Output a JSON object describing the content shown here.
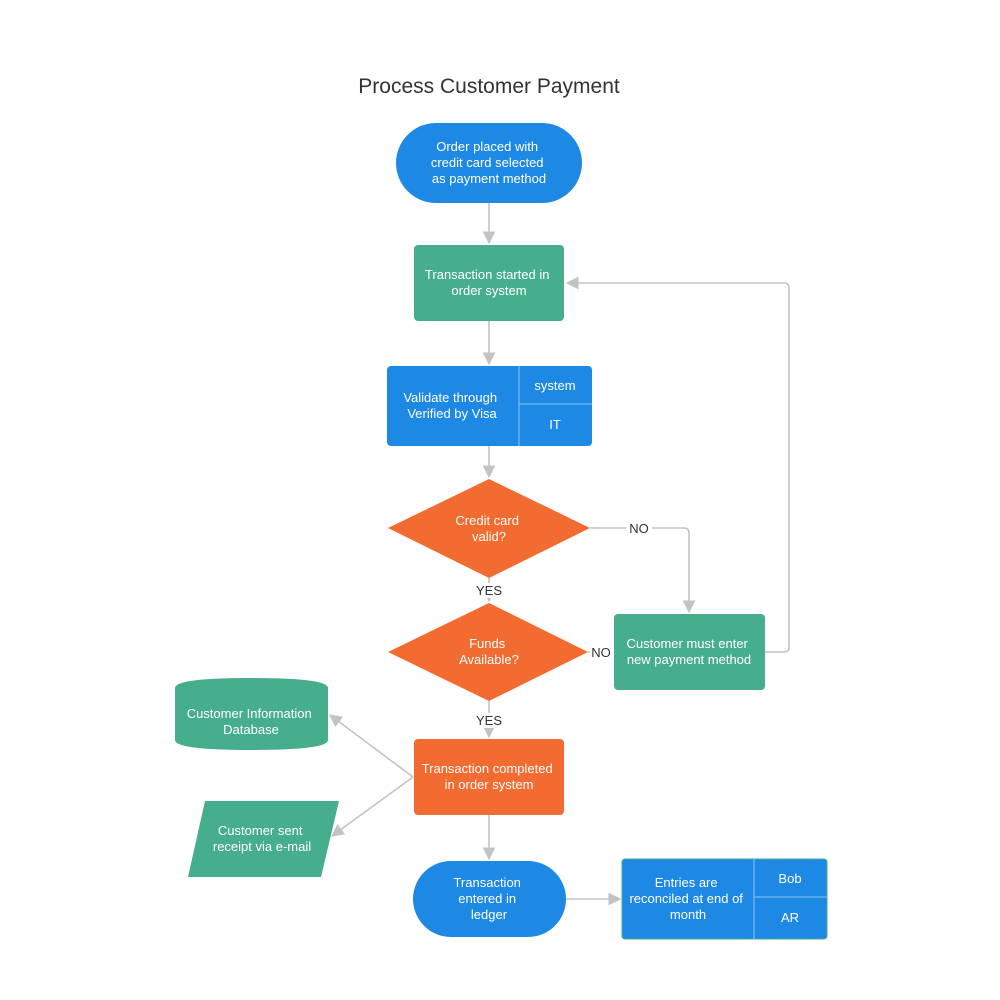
{
  "title": "Process Customer Payment",
  "colors": {
    "blue": "#1e88e5",
    "green": "#46ad8d",
    "orange": "#f26b30",
    "connector": "#c3c3c3",
    "divider": "#8cc4f1",
    "title_text": "#333333",
    "node_text": "#ffffff"
  },
  "nodes": {
    "start": {
      "type": "terminator",
      "color": "blue",
      "lines": [
        "Order placed with",
        "credit card selected",
        "as payment method"
      ]
    },
    "started": {
      "type": "process",
      "color": "green",
      "lines": [
        "Transaction started in",
        "order system"
      ]
    },
    "validate": {
      "type": "process-swimlane",
      "color": "blue",
      "lines": [
        "Validate through",
        "Verified by Visa"
      ],
      "lane_top": "system",
      "lane_bottom": "IT"
    },
    "cc_valid": {
      "type": "decision",
      "color": "orange",
      "lines": [
        "Credit card",
        "valid?"
      ]
    },
    "funds": {
      "type": "decision",
      "color": "orange",
      "lines": [
        "Funds",
        "Available?"
      ]
    },
    "new_payment": {
      "type": "process",
      "color": "green",
      "lines": [
        "Customer must enter",
        "new payment method"
      ]
    },
    "database": {
      "type": "database",
      "color": "green",
      "lines": [
        "Customer Information",
        "Database"
      ]
    },
    "receipt": {
      "type": "data",
      "color": "green",
      "lines": [
        "Customer sent",
        "receipt via e-mail"
      ]
    },
    "completed": {
      "type": "process",
      "color": "orange",
      "lines": [
        "Transaction completed",
        "in order system"
      ]
    },
    "ledger": {
      "type": "terminator",
      "color": "blue",
      "lines": [
        "Transaction",
        "entered in",
        "ledger"
      ]
    },
    "reconcile": {
      "type": "process-swimlane",
      "color": "blue",
      "lines": [
        "Entries are",
        "reconciled at end of",
        "month"
      ],
      "lane_top": "Bob",
      "lane_bottom": "AR"
    }
  },
  "edges": [
    {
      "from": "start",
      "to": "started",
      "label": ""
    },
    {
      "from": "started",
      "to": "validate",
      "label": ""
    },
    {
      "from": "validate",
      "to": "cc_valid",
      "label": ""
    },
    {
      "from": "cc_valid",
      "to": "funds",
      "label": "YES"
    },
    {
      "from": "cc_valid",
      "to": "new_payment",
      "label": "NO"
    },
    {
      "from": "funds",
      "to": "new_payment",
      "label": "NO"
    },
    {
      "from": "new_payment",
      "to": "started",
      "label": ""
    },
    {
      "from": "funds",
      "to": "completed",
      "label": "YES"
    },
    {
      "from": "completed",
      "to": "database",
      "label": ""
    },
    {
      "from": "completed",
      "to": "receipt",
      "label": ""
    },
    {
      "from": "completed",
      "to": "ledger",
      "label": ""
    },
    {
      "from": "ledger",
      "to": "reconcile",
      "label": ""
    }
  ]
}
